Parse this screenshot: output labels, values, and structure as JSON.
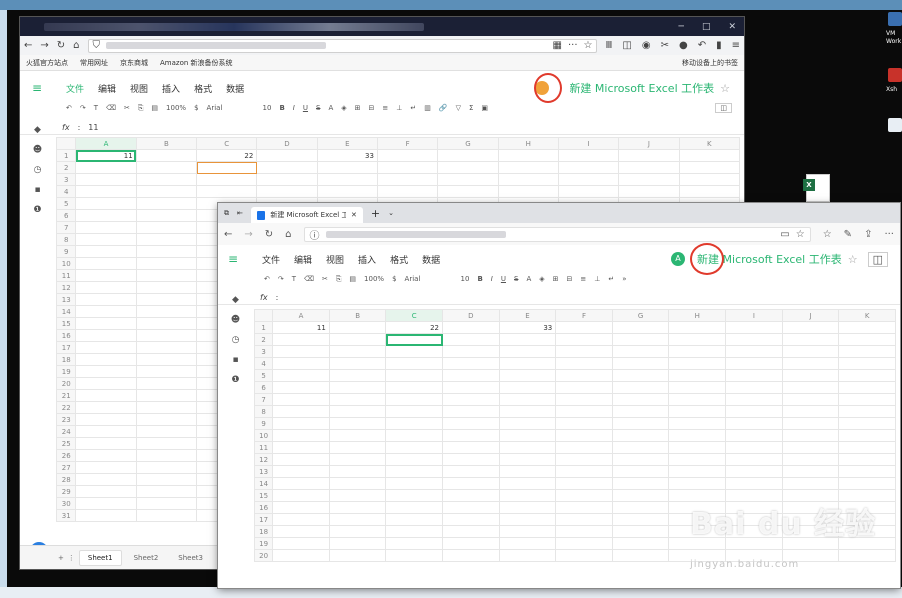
{
  "desktop": {
    "icon_labels": [
      "VM",
      "Work",
      "Xsh"
    ]
  },
  "win1": {
    "bookmarks": [
      "火狐官方站点",
      "常用网址",
      "京东商城",
      "Amazon 新浪备份系统"
    ],
    "bookmarks_right": "移动设备上的书签",
    "menu": [
      "文件",
      "编辑",
      "视图",
      "插入",
      "格式",
      "数据"
    ],
    "doc_title": "新建 Microsoft Excel 工作表",
    "avatar": "",
    "toolbar": {
      "zoom": "100%",
      "currency": "$",
      "font": "Arial",
      "size": "10"
    },
    "fx_label": "fx",
    "fx_value": "11",
    "columns": [
      "A",
      "B",
      "C",
      "D",
      "E",
      "F",
      "G",
      "H",
      "I",
      "J",
      "K"
    ],
    "cells": {
      "A1": "11",
      "C1": "22",
      "E1": "33"
    },
    "sheets": [
      "Sheet1",
      "Sheet2",
      "Sheet3"
    ],
    "avatar_bottom": "A"
  },
  "win2": {
    "tab_title": "新建 Microsoft Excel 工",
    "menu": [
      "文件",
      "编辑",
      "视图",
      "插入",
      "格式",
      "数据"
    ],
    "doc_title": "新建 Microsoft Excel 工作表",
    "avatar": "A",
    "toolbar": {
      "zoom": "100%",
      "currency": "$",
      "font": "Arial",
      "size": "10"
    },
    "fx_label": "fx",
    "fx_value": "",
    "columns": [
      "A",
      "B",
      "C",
      "D",
      "E",
      "F",
      "G",
      "H",
      "I",
      "J",
      "K"
    ],
    "cells": {
      "A1": "11",
      "C1": "22",
      "E1": "33"
    }
  },
  "colors": {
    "accent": "#2bb673",
    "avatar_orange": "#f0a23a",
    "annotation_red": "#e03a2c"
  },
  "watermark": {
    "main": "Bai du 经验",
    "url": "jingyan.baidu.com"
  }
}
